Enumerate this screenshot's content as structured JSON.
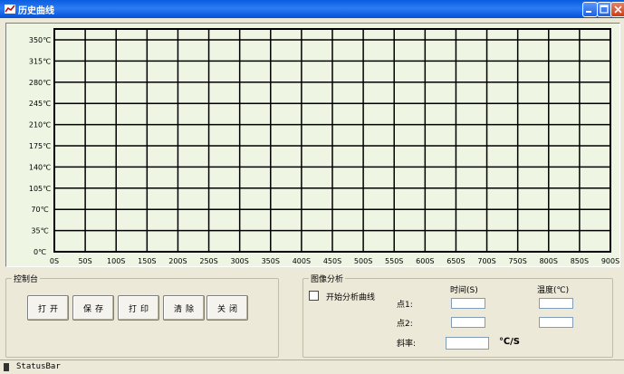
{
  "window": {
    "title": "历史曲线",
    "colors": {
      "titlebar": "#0a5ce0",
      "plot_bg": "#eef5e3",
      "grid": "#000000"
    }
  },
  "chart_data": {
    "type": "line",
    "x_ticks": [
      "0S",
      "50S",
      "100S",
      "150S",
      "200S",
      "250S",
      "300S",
      "350S",
      "400S",
      "450S",
      "500S",
      "550S",
      "600S",
      "650S",
      "700S",
      "750S",
      "800S",
      "850S",
      "900S"
    ],
    "y_ticks": [
      "350℃",
      "315℃",
      "280℃",
      "245℃",
      "210℃",
      "175℃",
      "140℃",
      "105℃",
      "70℃",
      "35℃",
      "0℃"
    ],
    "xlim": [
      0,
      900
    ],
    "ylim": [
      0,
      350
    ],
    "grid": true,
    "series": []
  },
  "control": {
    "title": "控制台",
    "buttons": [
      "打开",
      "保存",
      "打印",
      "清除",
      "关闭"
    ]
  },
  "analysis": {
    "title": "图像分析",
    "checkbox_label": "开始分析曲线",
    "time_header": "时间(S)",
    "temp_header": "温度(℃)",
    "point1_label": "点1:",
    "point2_label": "点2:",
    "slope_label": "斜率:",
    "slope_unit": "℃/S",
    "point1_time": "",
    "point1_temp": "",
    "point2_time": "",
    "point2_temp": "",
    "slope_value": ""
  },
  "statusbar": {
    "text": "StatusBar"
  }
}
